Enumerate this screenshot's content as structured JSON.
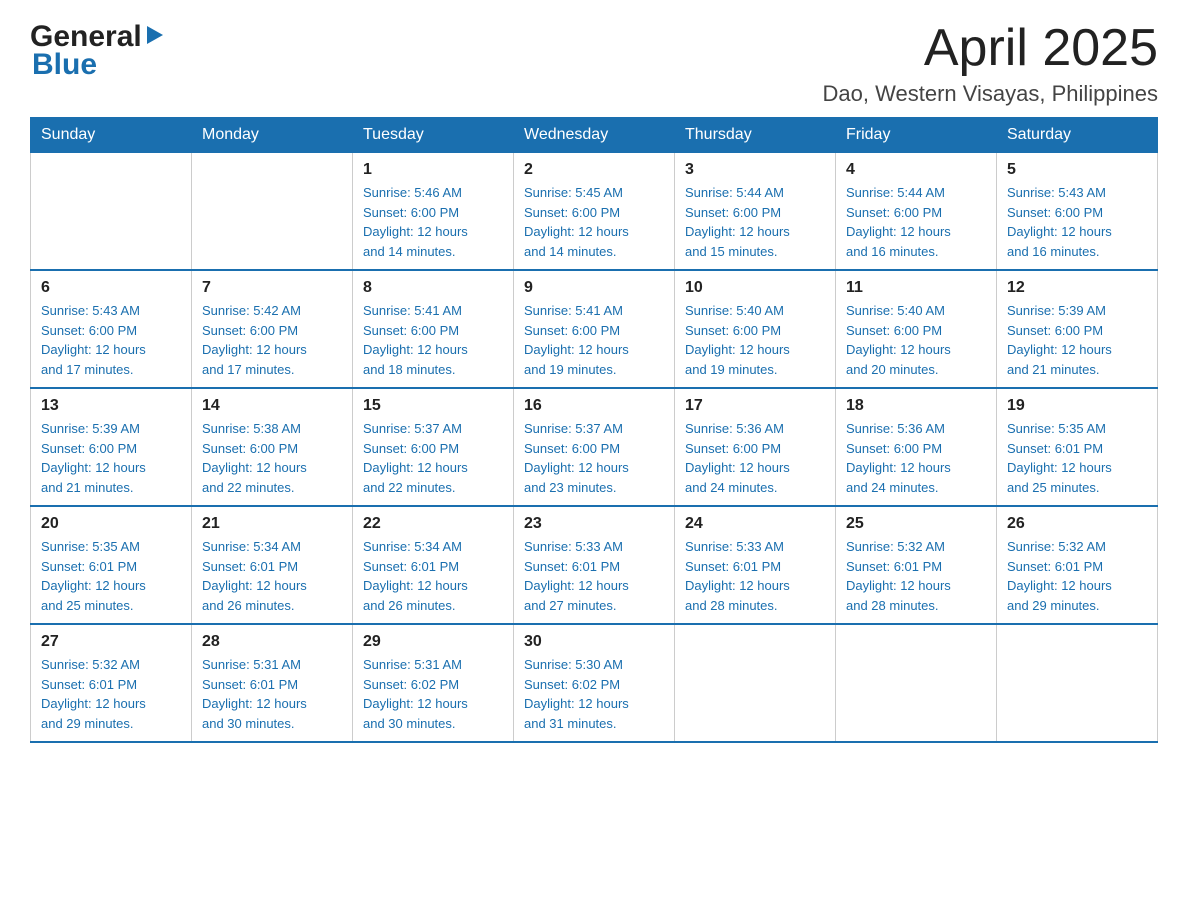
{
  "logo": {
    "general": "General",
    "blue": "Blue"
  },
  "title": {
    "month_year": "April 2025",
    "location": "Dao, Western Visayas, Philippines"
  },
  "weekdays": [
    "Sunday",
    "Monday",
    "Tuesday",
    "Wednesday",
    "Thursday",
    "Friday",
    "Saturday"
  ],
  "weeks": [
    [
      {
        "day": "",
        "info": ""
      },
      {
        "day": "",
        "info": ""
      },
      {
        "day": "1",
        "info": "Sunrise: 5:46 AM\nSunset: 6:00 PM\nDaylight: 12 hours\nand 14 minutes."
      },
      {
        "day": "2",
        "info": "Sunrise: 5:45 AM\nSunset: 6:00 PM\nDaylight: 12 hours\nand 14 minutes."
      },
      {
        "day": "3",
        "info": "Sunrise: 5:44 AM\nSunset: 6:00 PM\nDaylight: 12 hours\nand 15 minutes."
      },
      {
        "day": "4",
        "info": "Sunrise: 5:44 AM\nSunset: 6:00 PM\nDaylight: 12 hours\nand 16 minutes."
      },
      {
        "day": "5",
        "info": "Sunrise: 5:43 AM\nSunset: 6:00 PM\nDaylight: 12 hours\nand 16 minutes."
      }
    ],
    [
      {
        "day": "6",
        "info": "Sunrise: 5:43 AM\nSunset: 6:00 PM\nDaylight: 12 hours\nand 17 minutes."
      },
      {
        "day": "7",
        "info": "Sunrise: 5:42 AM\nSunset: 6:00 PM\nDaylight: 12 hours\nand 17 minutes."
      },
      {
        "day": "8",
        "info": "Sunrise: 5:41 AM\nSunset: 6:00 PM\nDaylight: 12 hours\nand 18 minutes."
      },
      {
        "day": "9",
        "info": "Sunrise: 5:41 AM\nSunset: 6:00 PM\nDaylight: 12 hours\nand 19 minutes."
      },
      {
        "day": "10",
        "info": "Sunrise: 5:40 AM\nSunset: 6:00 PM\nDaylight: 12 hours\nand 19 minutes."
      },
      {
        "day": "11",
        "info": "Sunrise: 5:40 AM\nSunset: 6:00 PM\nDaylight: 12 hours\nand 20 minutes."
      },
      {
        "day": "12",
        "info": "Sunrise: 5:39 AM\nSunset: 6:00 PM\nDaylight: 12 hours\nand 21 minutes."
      }
    ],
    [
      {
        "day": "13",
        "info": "Sunrise: 5:39 AM\nSunset: 6:00 PM\nDaylight: 12 hours\nand 21 minutes."
      },
      {
        "day": "14",
        "info": "Sunrise: 5:38 AM\nSunset: 6:00 PM\nDaylight: 12 hours\nand 22 minutes."
      },
      {
        "day": "15",
        "info": "Sunrise: 5:37 AM\nSunset: 6:00 PM\nDaylight: 12 hours\nand 22 minutes."
      },
      {
        "day": "16",
        "info": "Sunrise: 5:37 AM\nSunset: 6:00 PM\nDaylight: 12 hours\nand 23 minutes."
      },
      {
        "day": "17",
        "info": "Sunrise: 5:36 AM\nSunset: 6:00 PM\nDaylight: 12 hours\nand 24 minutes."
      },
      {
        "day": "18",
        "info": "Sunrise: 5:36 AM\nSunset: 6:00 PM\nDaylight: 12 hours\nand 24 minutes."
      },
      {
        "day": "19",
        "info": "Sunrise: 5:35 AM\nSunset: 6:01 PM\nDaylight: 12 hours\nand 25 minutes."
      }
    ],
    [
      {
        "day": "20",
        "info": "Sunrise: 5:35 AM\nSunset: 6:01 PM\nDaylight: 12 hours\nand 25 minutes."
      },
      {
        "day": "21",
        "info": "Sunrise: 5:34 AM\nSunset: 6:01 PM\nDaylight: 12 hours\nand 26 minutes."
      },
      {
        "day": "22",
        "info": "Sunrise: 5:34 AM\nSunset: 6:01 PM\nDaylight: 12 hours\nand 26 minutes."
      },
      {
        "day": "23",
        "info": "Sunrise: 5:33 AM\nSunset: 6:01 PM\nDaylight: 12 hours\nand 27 minutes."
      },
      {
        "day": "24",
        "info": "Sunrise: 5:33 AM\nSunset: 6:01 PM\nDaylight: 12 hours\nand 28 minutes."
      },
      {
        "day": "25",
        "info": "Sunrise: 5:32 AM\nSunset: 6:01 PM\nDaylight: 12 hours\nand 28 minutes."
      },
      {
        "day": "26",
        "info": "Sunrise: 5:32 AM\nSunset: 6:01 PM\nDaylight: 12 hours\nand 29 minutes."
      }
    ],
    [
      {
        "day": "27",
        "info": "Sunrise: 5:32 AM\nSunset: 6:01 PM\nDaylight: 12 hours\nand 29 minutes."
      },
      {
        "day": "28",
        "info": "Sunrise: 5:31 AM\nSunset: 6:01 PM\nDaylight: 12 hours\nand 30 minutes."
      },
      {
        "day": "29",
        "info": "Sunrise: 5:31 AM\nSunset: 6:02 PM\nDaylight: 12 hours\nand 30 minutes."
      },
      {
        "day": "30",
        "info": "Sunrise: 5:30 AM\nSunset: 6:02 PM\nDaylight: 12 hours\nand 31 minutes."
      },
      {
        "day": "",
        "info": ""
      },
      {
        "day": "",
        "info": ""
      },
      {
        "day": "",
        "info": ""
      }
    ]
  ]
}
